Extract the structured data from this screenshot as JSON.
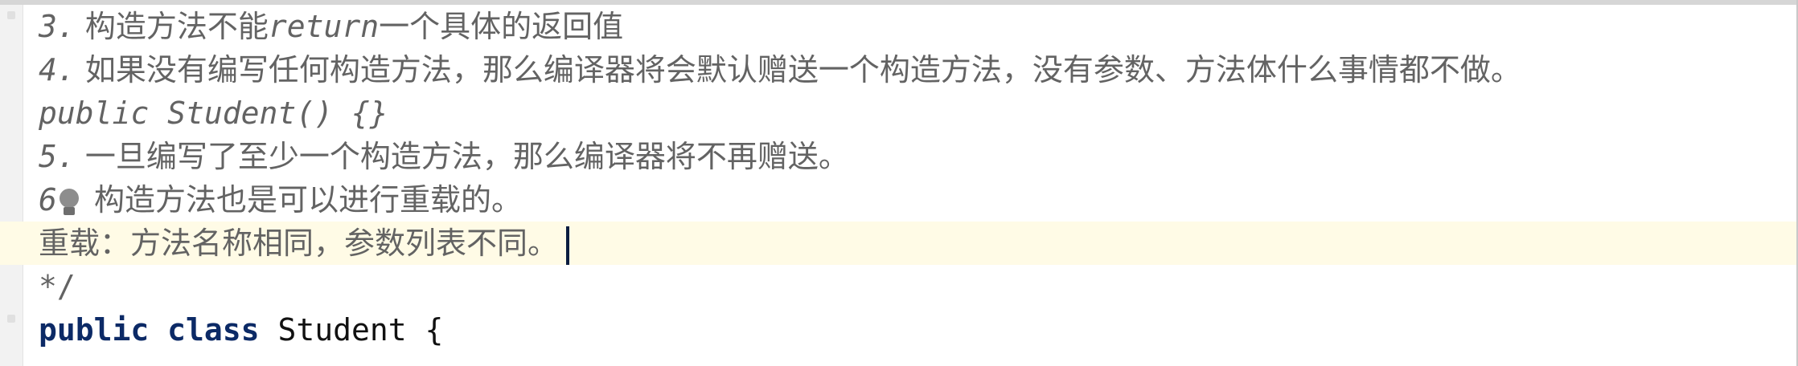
{
  "editor": {
    "lines": [
      {
        "num": "3.",
        "pre": " 构造方法不能",
        "italic": "return",
        "post": "一个具体的返回值"
      },
      {
        "num": "4.",
        "text": " 如果没有编写任何构造方法，那么编译器将会默认赠送一个构造方法，没有参数、方法体什么事情都不做。"
      },
      {
        "code": "public Student() {}"
      },
      {
        "num": "5.",
        "text": " 一旦编写了至少一个构造方法，那么编译器将不再赠送。"
      },
      {
        "num": "6",
        "text": " 构造方法也是可以进行重载的。"
      },
      {
        "text": "重载：方法名称相同，参数列表不同。"
      },
      {
        "text": " */"
      },
      {
        "kw1": "public",
        "kw2": "class",
        "name": "Student",
        "brace": "{"
      }
    ]
  }
}
